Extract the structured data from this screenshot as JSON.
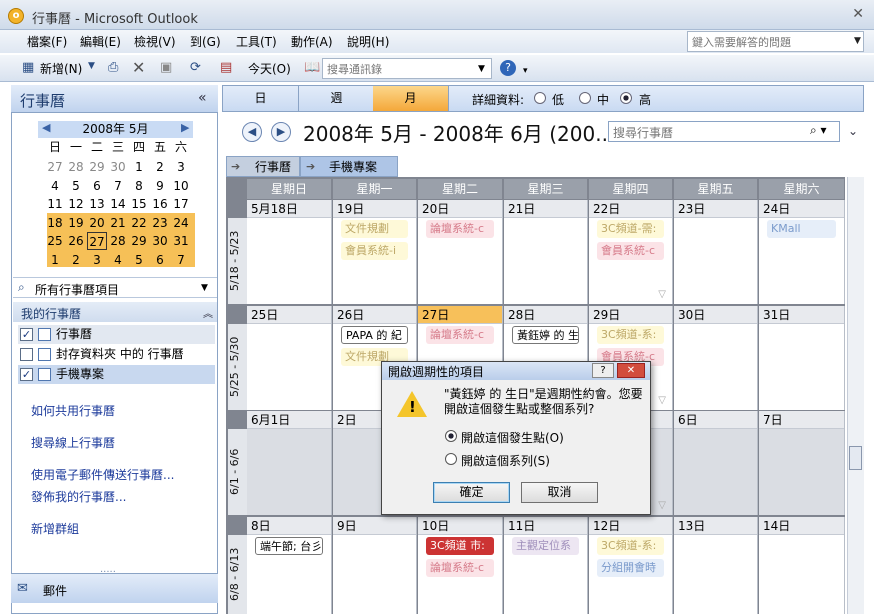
{
  "window": {
    "title": "行事曆 - Microsoft Outlook"
  },
  "menu": [
    "檔案(F)",
    "編輯(E)",
    "檢視(V)",
    "到(G)",
    "工具(T)",
    "動作(A)",
    "說明(H)"
  ],
  "help_search": {
    "placeholder": "鍵入需要解答的問題"
  },
  "toolbar": {
    "new_label": "新增(N)",
    "today_label": "今天(O)",
    "address_search": "搜尋通訊錄"
  },
  "left": {
    "title": "行事曆",
    "mini_cal": {
      "month": "2008年 5月",
      "weekdays": [
        "日",
        "一",
        "二",
        "三",
        "四",
        "五",
        "六"
      ],
      "days": [
        [
          "27",
          "28",
          "29",
          "30",
          "1",
          "2",
          "3"
        ],
        [
          "4",
          "5",
          "6",
          "7",
          "8",
          "9",
          "10"
        ],
        [
          "11",
          "12",
          "13",
          "14",
          "15",
          "16",
          "17"
        ],
        [
          "18",
          "19",
          "20",
          "21",
          "22",
          "23",
          "24"
        ],
        [
          "25",
          "26",
          "27",
          "28",
          "29",
          "30",
          "31"
        ],
        [
          "1",
          "2",
          "3",
          "4",
          "5",
          "6",
          "7"
        ]
      ]
    },
    "all_items": "所有行事曆項目",
    "my_calendars": "我的行事曆",
    "calendars": [
      {
        "label": "行事曆",
        "checked": true
      },
      {
        "label": "封存資料夾 中的 行事曆",
        "checked": false
      },
      {
        "label": "手機專案",
        "checked": true
      }
    ],
    "links": [
      "如何共用行事曆",
      "搜尋線上行事曆",
      "使用電子郵件傳送行事曆...",
      "發佈我的行事曆...",
      "新增群組"
    ],
    "mail": "郵件"
  },
  "view": {
    "tabs": [
      "日",
      "週",
      "月"
    ],
    "detail_label": "詳細資料:",
    "detail_options": [
      "低",
      "中",
      "高"
    ]
  },
  "header": {
    "range": "2008年 5月 - 2008年 6月 (200...",
    "search_placeholder": "搜尋行事曆"
  },
  "cal_tabs": [
    "行事曆",
    "手機專案"
  ],
  "weekdays": [
    "星期日",
    "星期一",
    "星期二",
    "星期三",
    "星期四",
    "星期五",
    "星期六"
  ],
  "weeks": [
    {
      "label": "5/18 - 5/23",
      "days": [
        "5月18日",
        "19日",
        "20日",
        "21日",
        "22日",
        "23日",
        "24日"
      ],
      "events": [
        [],
        [
          {
            "t": "文件規劃",
            "c": "yellow"
          },
          {
            "t": "會員系統-i",
            "c": "yellow"
          }
        ],
        [
          {
            "t": "論壇系統-c",
            "c": "pink"
          }
        ],
        [],
        [
          {
            "t": "3C頻道-需:",
            "c": "yellow"
          },
          {
            "t": "會員系統-c",
            "c": "pink"
          }
        ],
        [],
        [
          {
            "t": "KMall",
            "c": "blue"
          }
        ]
      ]
    },
    {
      "label": "5/25 - 5/30",
      "days": [
        "25日",
        "26日",
        "27日",
        "28日",
        "29日",
        "30日",
        "31日"
      ],
      "events": [
        [],
        [
          {
            "t": "PAPA 的 紀",
            "c": "white"
          },
          {
            "t": "文件規劃",
            "c": "yellow"
          }
        ],
        [
          {
            "t": "論壇系統-c",
            "c": "pink"
          }
        ],
        [
          {
            "t": "黃鈺婷 的 生",
            "c": "white"
          }
        ],
        [
          {
            "t": "3C頻道-系:",
            "c": "yellow"
          },
          {
            "t": "會員系統-c",
            "c": "pink"
          }
        ],
        [],
        []
      ]
    },
    {
      "label": "6/1 - 6/6",
      "days": [
        "6月1日",
        "2日",
        "",
        "",
        "",
        "6日",
        "7日"
      ],
      "events": [
        [],
        [],
        [],
        [],
        [],
        [],
        []
      ]
    },
    {
      "label": "6/8 - 6/13",
      "days": [
        "8日",
        "9日",
        "10日",
        "11日",
        "12日",
        "13日",
        "14日"
      ],
      "events": [
        [
          {
            "t": "端午節; 台彡",
            "c": "white"
          }
        ],
        [],
        [
          {
            "t": "3C頻道 市:",
            "c": "red"
          },
          {
            "t": "論壇系統-c",
            "c": "pink"
          }
        ],
        [
          {
            "t": "主觀定位系",
            "c": "purple"
          }
        ],
        [
          {
            "t": "3C頻道-系:",
            "c": "yellow"
          },
          {
            "t": "分組開會時",
            "c": "blue"
          }
        ],
        [],
        []
      ]
    }
  ],
  "dialog": {
    "title": "開啟週期性的項目",
    "message": "\"黃鈺婷 的 生日\"是週期性約會。您要開啟這個發生點或整個系列?",
    "opt1": "開啟這個發生點(O)",
    "opt2": "開啟這個系列(S)",
    "ok": "確定",
    "cancel": "取消"
  }
}
